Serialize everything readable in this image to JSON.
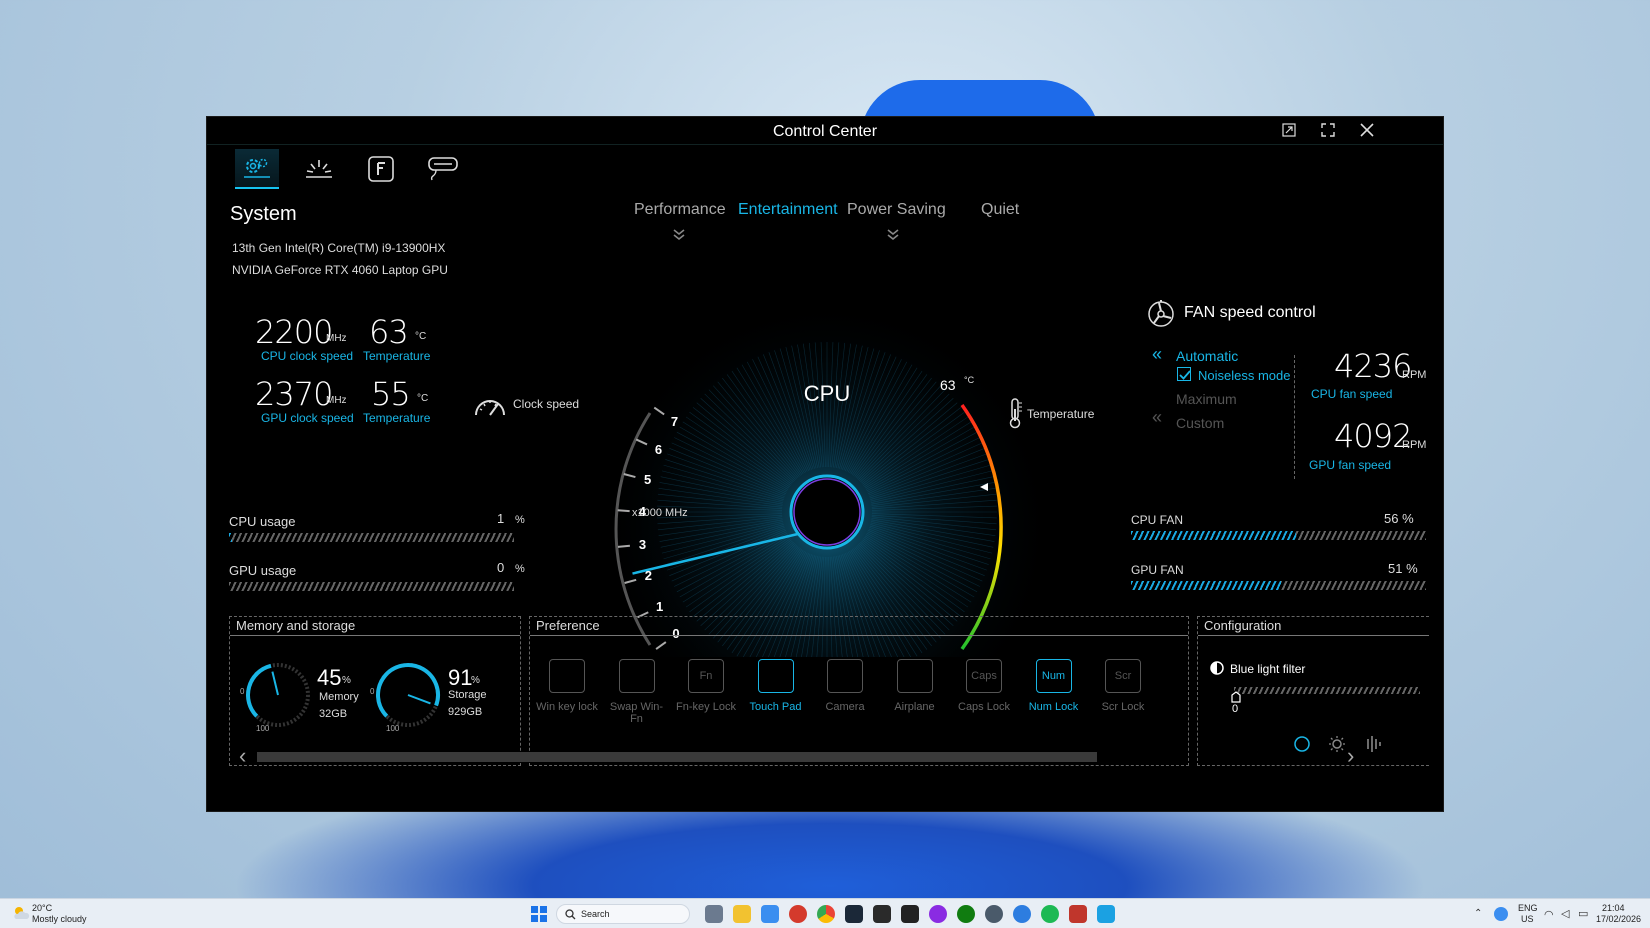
{
  "window": {
    "title": "Control Center",
    "restore_icon": "restore-icon",
    "fullscreen_icon": "fullscreen-icon",
    "close_icon": "close-icon"
  },
  "top_tabs": [
    "system-settings-icon",
    "lighting-icon",
    "function-key-icon",
    "input-devices-icon"
  ],
  "system": {
    "title": "System",
    "cpu_name": "13th Gen Intel(R) Core(TM) i9-13900HX",
    "gpu_name": "NVIDIA GeForce RTX 4060 Laptop GPU",
    "cpu_clock": "2200",
    "cpu_clock_unit": "MHz",
    "cpu_clock_label": "CPU clock speed",
    "cpu_temp": "63",
    "cpu_temp_unit": "°C",
    "cpu_temp_label": "Temperature",
    "gpu_clock": "2370",
    "gpu_clock_unit": "MHz",
    "gpu_clock_label": "GPU clock speed",
    "gpu_temp": "55",
    "gpu_temp_unit": "°C",
    "gpu_temp_label": "Temperature"
  },
  "usage": {
    "cpu_label": "CPU usage",
    "cpu_value": "1",
    "cpu_pct": 1,
    "gpu_label": "GPU usage",
    "gpu_value": "0",
    "gpu_pct": 0,
    "unit": "%"
  },
  "modes": {
    "items": [
      "Performance",
      "Entertainment",
      "Power Saving",
      "Quiet"
    ],
    "active": "Entertainment"
  },
  "gauge": {
    "center_label": "CPU",
    "clock_label": "Clock speed",
    "ticks": [
      "7",
      "6",
      "5",
      "4",
      "3",
      "2",
      "1",
      "0"
    ],
    "scale_label": "x1000 MHz",
    "clock_value_khz": 2.2,
    "temp_value": "63",
    "temp_unit": "°C",
    "temp_label": "Temperature"
  },
  "fan": {
    "title": "FAN speed control",
    "automatic": "Automatic",
    "noiseless": "Noiseless mode",
    "noiseless_checked": true,
    "maximum": "Maximum",
    "custom": "Custom",
    "cpu_rpm": "4236",
    "cpu_rpm_unit": "RPM",
    "cpu_rpm_label": "CPU fan speed",
    "gpu_rpm": "4092",
    "gpu_rpm_unit": "RPM",
    "gpu_rpm_label": "GPU fan speed",
    "cpu_fan_label": "CPU FAN",
    "cpu_fan_value": "56 %",
    "cpu_fan_pct": 56,
    "gpu_fan_label": "GPU FAN",
    "gpu_fan_value": "51 %",
    "gpu_fan_pct": 51
  },
  "memory": {
    "title": "Memory and storage",
    "mem_pct": "45",
    "mem_pct_num": 45,
    "mem_label": "Memory",
    "mem_size": "32GB",
    "sto_pct": "91",
    "sto_pct_num": 91,
    "sto_label": "Storage",
    "sto_size": "929GB",
    "pct_unit": "%",
    "dial_min": "0",
    "dial_max": "100"
  },
  "preference": {
    "title": "Preference",
    "items": [
      {
        "label": "Win key lock",
        "icon": "win-key-lock-icon",
        "on": false
      },
      {
        "label": "Swap Win-Fn",
        "icon": "swap-win-fn-icon",
        "on": false
      },
      {
        "label": "Fn-key Lock",
        "icon": "fn-key-lock-icon",
        "on": false,
        "glyph": "Fn"
      },
      {
        "label": "Touch Pad",
        "icon": "touch-pad-icon",
        "on": true
      },
      {
        "label": "Camera",
        "icon": "camera-icon",
        "on": false
      },
      {
        "label": "Airplane",
        "icon": "airplane-icon",
        "on": false
      },
      {
        "label": "Caps Lock",
        "icon": "caps-lock-icon",
        "on": false,
        "glyph": "Caps"
      },
      {
        "label": "Num Lock",
        "icon": "num-lock-icon",
        "on": true,
        "glyph": "Num"
      },
      {
        "label": "Scr Lock",
        "icon": "scroll-lock-icon",
        "on": false,
        "glyph": "Scr"
      }
    ]
  },
  "configuration": {
    "title": "Configuration",
    "blue_light_label": "Blue light filter",
    "blue_light_value": "0",
    "blue_light_level": 0
  },
  "taskbar": {
    "weather_temp": "20°C",
    "weather_desc": "Mostly cloudy",
    "search_placeholder": "Search",
    "lang": "ENG",
    "region": "US",
    "time": "21:04",
    "date": "17/02/2026"
  },
  "colors": {
    "accent": "#19b6e6",
    "window_bg": "#000000",
    "taskbar_bg": "#e8eef5"
  }
}
